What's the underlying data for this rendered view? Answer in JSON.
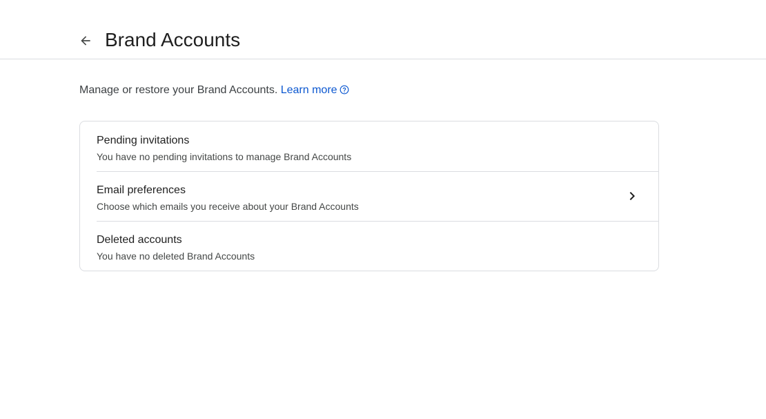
{
  "header": {
    "back_icon": "arrow-back-icon",
    "title": "Brand Accounts"
  },
  "intro": {
    "text": "Manage or restore your Brand Accounts.",
    "link_label": "Learn more",
    "help_icon": "help-circle-icon"
  },
  "sections": [
    {
      "title": "Pending invitations",
      "subtitle": "You have no pending invitations to manage Brand Accounts"
    },
    {
      "title": "Email preferences",
      "subtitle": "Choose which emails you receive about your Brand Accounts",
      "icon": "chevron-right-icon"
    },
    {
      "title": "Deleted accounts",
      "subtitle": "You have no deleted Brand Accounts"
    }
  ],
  "colors": {
    "link": "#0b57d0",
    "divider": "#dadce0",
    "text_primary": "#1f1f1f",
    "text_secondary": "#444746"
  }
}
